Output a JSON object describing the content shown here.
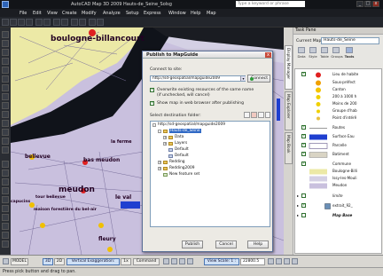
{
  "titlebar": {
    "app_title": "AutoCAD Map 3D 2009   Hauts-de_Seine_Solsg",
    "search_placeholder": "Type a keyword or phrase",
    "min": "_",
    "max": "□",
    "close": "x"
  },
  "menu": [
    "File",
    "Edit",
    "View",
    "Create",
    "Modify",
    "Analyze",
    "Setup",
    "Express",
    "Window",
    "Help",
    "Map"
  ],
  "map": {
    "labels": {
      "boulogne": "boulogne-billancourt",
      "bellevue": "bellevue",
      "bas_meudon": "bas meudon",
      "la_ferme": "la ferme",
      "meudon": "meudon",
      "capucins": "capucins",
      "fort_bellevue": "tour bellevue",
      "maison_forestiere": "maison forestière du bel-air",
      "le_val": "le val",
      "fleury": "fleury"
    }
  },
  "dialog": {
    "title": "Publish to MapGuide",
    "close": "x",
    "connect_label": "Connect to site:",
    "site_url": "http://sd-geospatial/mapguide2009",
    "connect_button": "Connect",
    "overwrite_label": "Overwrite existing resources of the same name",
    "overwrite_sub": "(if unchecked, will cancel)",
    "show_browser_label": "Show map in web browser after publishing",
    "dest_label": "Select destination folder:",
    "tree": {
      "root": "http://sd-geospatial/mapguide2009",
      "items": [
        "Hauts-de_Seine",
        "Data",
        "Layers",
        "Default",
        "Default",
        "Redding",
        "Redding2009",
        "New feature set"
      ]
    },
    "buttons": {
      "publish": "Publish",
      "cancel": "Cancel",
      "help": "Help"
    }
  },
  "taskpane": {
    "header": "Task Pane",
    "vtabs": [
      "Display Manager",
      "Map Explorer",
      "Map Book"
    ],
    "current_map_label": "Current Map:",
    "current_map_value": "Hauts-de_Seine",
    "tool_tabs": [
      "Data",
      "Style",
      "Table",
      "Groups",
      "Tools"
    ],
    "layers": [
      "Lieu de habite",
      "Sous-préfect",
      "Canton",
      "200 à 1000 h",
      "Moins de 200",
      "Groupe d'hab",
      "Point d'intérê",
      "Routes",
      "Surface Eau",
      "Parcelle",
      "Batiment",
      "Commune",
      "Boulogne-Billi",
      "Issy-les-Mouli",
      "Meudon",
      "limite",
      "extrait_92_",
      "Map Base"
    ]
  },
  "statusbar": {
    "model_btn": "MODEL",
    "b3d": "3D",
    "b2d": "2D",
    "vertical_exag": "Vertical Exaggeration:",
    "vertical_val": "1x",
    "command": "Command",
    "view_scale": "View Scale: 1 :",
    "scale_value": "22800.5",
    "hint": "Press pick button and drag to pan."
  },
  "colors": {
    "accent": "#316ac5",
    "map_background": "#c9c0de",
    "yellow_area": "#ece9a6",
    "river": "#000000",
    "place_dot_red": "#e02020",
    "place_dot_yellow": "#f0c000"
  }
}
